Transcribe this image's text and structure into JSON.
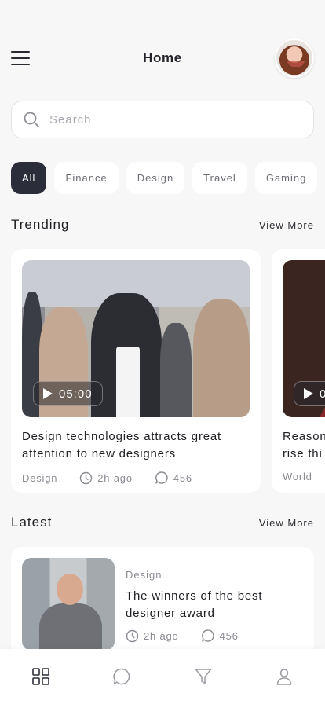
{
  "header": {
    "title": "Home"
  },
  "search": {
    "placeholder": "Search"
  },
  "categories": [
    "All",
    "Finance",
    "Design",
    "Travel",
    "Gaming"
  ],
  "trending": {
    "title": "Trending",
    "view_more": "View More",
    "cards": [
      {
        "duration": "05:00",
        "title": "Design technologies attracts great attention to new designers",
        "category": "Design",
        "time": "2h ago",
        "comments": "456"
      },
      {
        "duration": "0",
        "title": "Reason rise thi",
        "category": "World"
      }
    ]
  },
  "latest": {
    "title": "Latest",
    "view_more": "View More",
    "items": [
      {
        "category": "Design",
        "title": "The winners of the best designer award",
        "time": "2h ago",
        "comments": "456"
      }
    ]
  },
  "tabbar": {
    "icons": [
      "grid-icon",
      "chat-icon",
      "filter-icon",
      "user-icon"
    ]
  },
  "colors": {
    "active_chip": "#2b2d3a",
    "background": "#f7f7f8",
    "muted_text": "#8a8a92"
  }
}
